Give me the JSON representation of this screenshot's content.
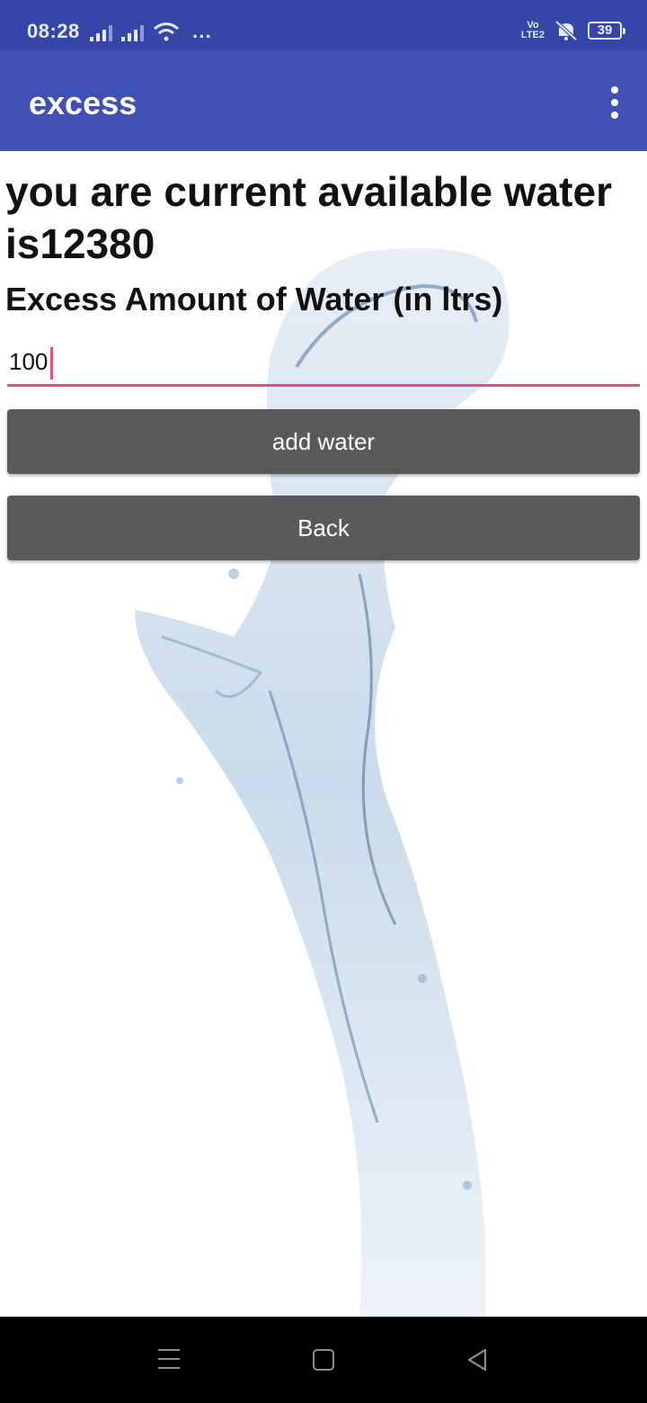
{
  "status_bar": {
    "time": "08:28",
    "volte_top": "Vo",
    "volte_bottom": "LTE2",
    "battery": "39",
    "icons": [
      "signal-icon",
      "signal-icon",
      "wifi-icon",
      "more-dots-icon",
      "volte-icon",
      "mute-icon",
      "battery-icon"
    ]
  },
  "app_bar": {
    "title": "excess",
    "menu_icon": "overflow-menu-icon"
  },
  "main": {
    "headline": "you are current available water is12380",
    "subhead": "Excess Amount of Water (in ltrs)",
    "input_value": "100",
    "add_button": "add water",
    "back_button": "Back"
  },
  "nav_bar": {
    "icons": [
      "recents-icon",
      "home-icon",
      "back-icon"
    ]
  },
  "colors": {
    "status_bar": "#3446a8",
    "app_bar": "#3f51b5",
    "accent": "#e0508a",
    "button": "#5a5a5c"
  }
}
